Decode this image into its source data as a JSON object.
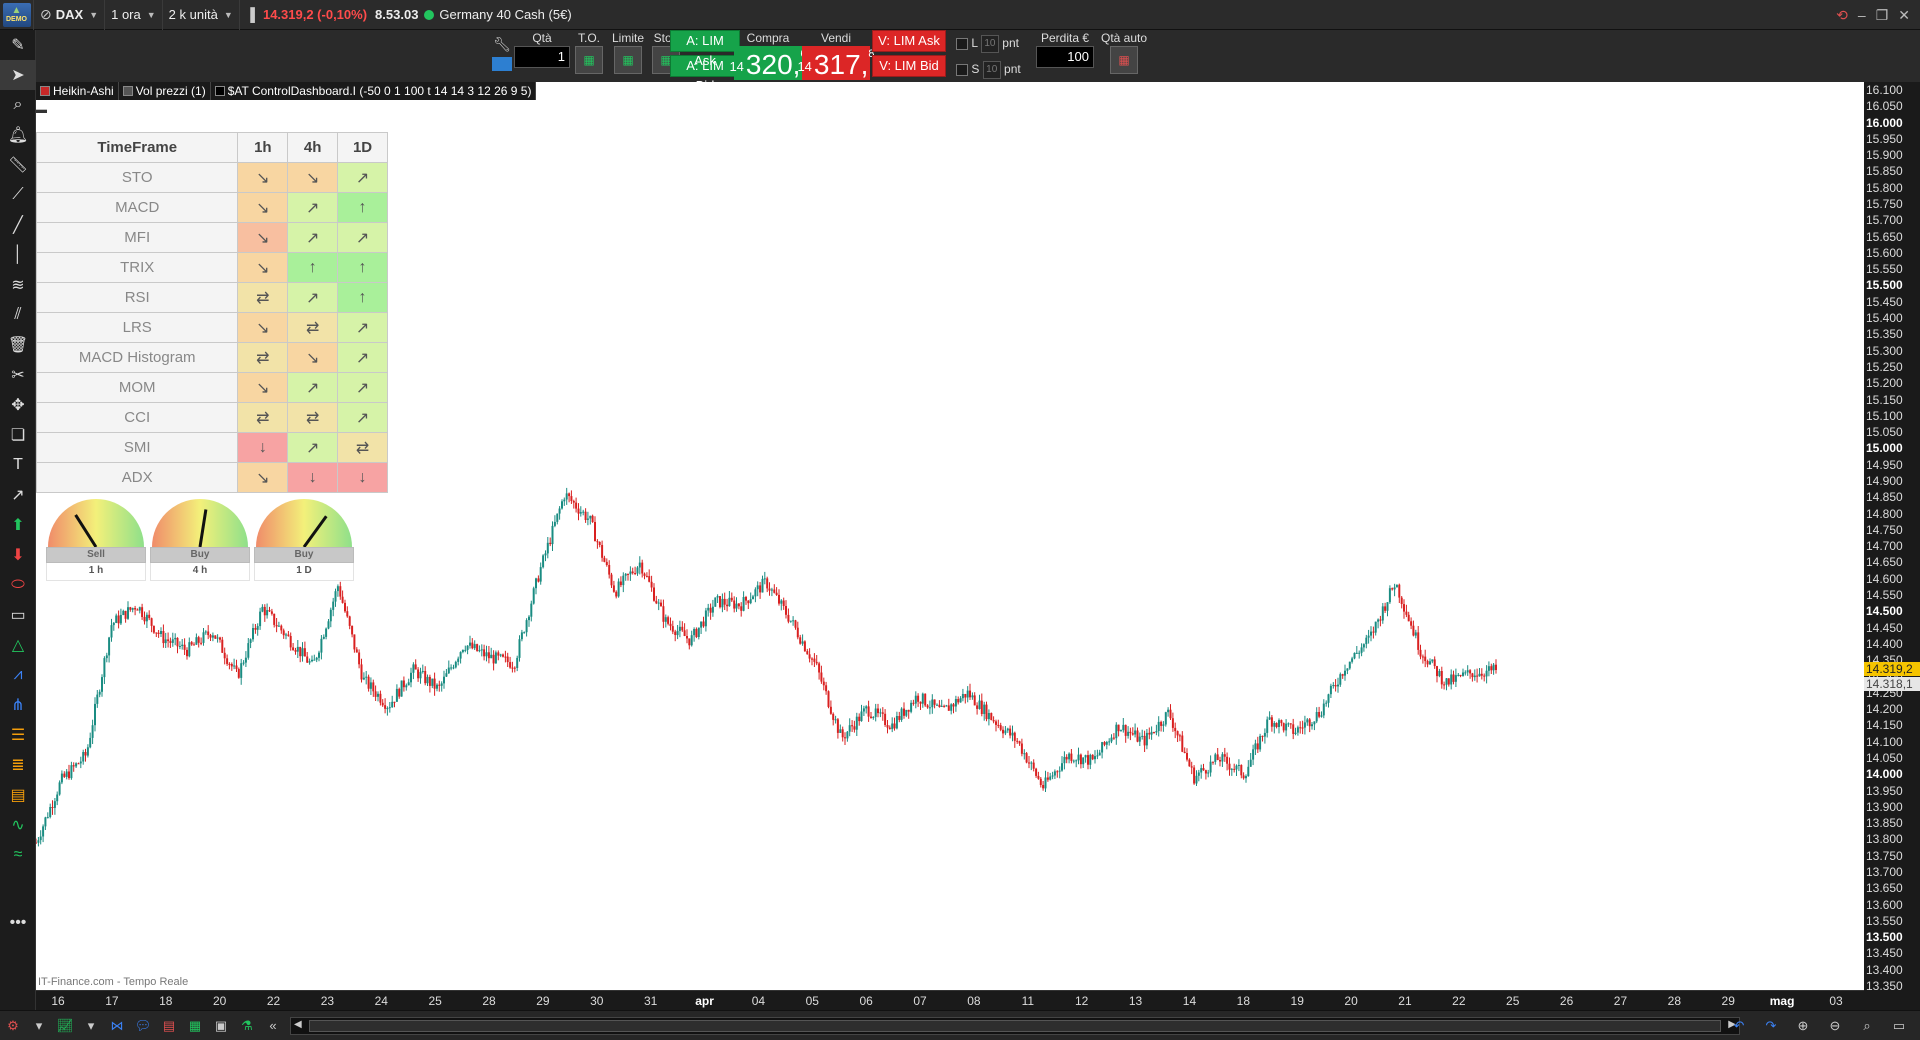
{
  "titlebar": {
    "demo_badge": "DEMO",
    "instrument": "DAX",
    "timeframe": "1 ora",
    "units": "2 k unità",
    "last_price": "14.319,2 (-0,10%)",
    "time": "8.53.03",
    "market_name": "Germany 40 Cash (5€)"
  },
  "tradebar": {
    "qty_label": "Qtà",
    "qty_value": "1",
    "to_label": "T.O.",
    "limit_label": "Limite",
    "stop_label": "Stop",
    "buy_ask_btn": "A: LIM Ask",
    "buy_bid_btn": "A: LIM Bid",
    "buy_label": "Compra",
    "buy_price_prefix": "14",
    "buy_price_main": "320,",
    "buy_price_sup": "6",
    "sell_label": "Vendi",
    "sell_price_prefix": "14",
    "sell_price_main": "317,",
    "sell_price_sup": "8",
    "sell_ask_btn": "V: LIM Ask",
    "sell_bid_btn": "V: LIM Bid",
    "l_label": "L",
    "s_label": "S",
    "l_value": "10",
    "s_value": "10",
    "pnt_label": "pnt",
    "loss_label": "Perdita €",
    "loss_value": "100",
    "auto_qty_label": "Qtà auto"
  },
  "legend": [
    {
      "label": "Heikin-Ashi",
      "color": "#c62828"
    },
    {
      "label": "Vol prezzi (1)",
      "color": "#555555"
    },
    {
      "label": "$AT ControlDashboard.I (-50 0 1 100 t 14 14 3 12 26 9 5)",
      "color": "#000000"
    }
  ],
  "dashboard": {
    "header": "TimeFrame",
    "columns": [
      "1h",
      "4h",
      "1D"
    ],
    "rows": [
      {
        "name": "STO",
        "cells": [
          {
            "arrow": "↘",
            "state": "down-soft"
          },
          {
            "arrow": "↘",
            "state": "down-soft"
          },
          {
            "arrow": "↗",
            "state": "up-soft"
          }
        ]
      },
      {
        "name": "MACD",
        "cells": [
          {
            "arrow": "↘",
            "state": "down-soft"
          },
          {
            "arrow": "↗",
            "state": "up-soft"
          },
          {
            "arrow": "↑",
            "state": "up-strong"
          }
        ]
      },
      {
        "name": "MFI",
        "cells": [
          {
            "arrow": "↘",
            "state": "down-mid"
          },
          {
            "arrow": "↗",
            "state": "up-soft"
          },
          {
            "arrow": "↗",
            "state": "up-soft"
          }
        ]
      },
      {
        "name": "TRIX",
        "cells": [
          {
            "arrow": "↘",
            "state": "down-soft"
          },
          {
            "arrow": "↑",
            "state": "up-strong"
          },
          {
            "arrow": "↑",
            "state": "up-strong"
          }
        ]
      },
      {
        "name": "RSI",
        "cells": [
          {
            "arrow": "⇄",
            "state": "neutral"
          },
          {
            "arrow": "↗",
            "state": "up-soft"
          },
          {
            "arrow": "↑",
            "state": "up-strong"
          }
        ]
      },
      {
        "name": "LRS",
        "cells": [
          {
            "arrow": "↘",
            "state": "down-soft"
          },
          {
            "arrow": "⇄",
            "state": "neutral"
          },
          {
            "arrow": "↗",
            "state": "up-soft"
          }
        ]
      },
      {
        "name": "MACD Histogram",
        "cells": [
          {
            "arrow": "⇄",
            "state": "neutral"
          },
          {
            "arrow": "↘",
            "state": "down-soft"
          },
          {
            "arrow": "↗",
            "state": "up-soft"
          }
        ]
      },
      {
        "name": "MOM",
        "cells": [
          {
            "arrow": "↘",
            "state": "down-soft"
          },
          {
            "arrow": "↗",
            "state": "up-soft"
          },
          {
            "arrow": "↗",
            "state": "up-soft"
          }
        ]
      },
      {
        "name": "CCI",
        "cells": [
          {
            "arrow": "⇄",
            "state": "neutral"
          },
          {
            "arrow": "⇄",
            "state": "neutral"
          },
          {
            "arrow": "↗",
            "state": "up-soft"
          }
        ]
      },
      {
        "name": "SMI",
        "cells": [
          {
            "arrow": "↓",
            "state": "down-strong"
          },
          {
            "arrow": "↗",
            "state": "up-soft"
          },
          {
            "arrow": "⇄",
            "state": "neutral"
          }
        ]
      },
      {
        "name": "ADX",
        "cells": [
          {
            "arrow": "↘",
            "state": "down-soft"
          },
          {
            "arrow": "↓",
            "state": "down-strong"
          },
          {
            "arrow": "↓",
            "state": "down-strong"
          }
        ]
      }
    ],
    "state_colors": {
      "up-strong": "#a9f09a",
      "up-soft": "#d6f3a8",
      "neutral": "#f2e3a8",
      "down-soft": "#f8d6a2",
      "down-mid": "#f8bfa0",
      "down-strong": "#f7a3a3"
    },
    "gauges": [
      {
        "signal": "Sell",
        "timeframe": "1 h",
        "needle": 0.32
      },
      {
        "signal": "Buy",
        "timeframe": "4 h",
        "needle": 0.55
      },
      {
        "signal": "Buy",
        "timeframe": "1 D",
        "needle": 0.7
      }
    ]
  },
  "price_axis": {
    "ticks": [
      "16.100",
      "16.050",
      "16.000",
      "15.950",
      "15.900",
      "15.850",
      "15.800",
      "15.750",
      "15.700",
      "15.650",
      "15.600",
      "15.550",
      "15.500",
      "15.450",
      "15.400",
      "15.350",
      "15.300",
      "15.250",
      "15.200",
      "15.150",
      "15.100",
      "15.050",
      "15.000",
      "14.950",
      "14.900",
      "14.850",
      "14.800",
      "14.750",
      "14.700",
      "14.650",
      "14.600",
      "14.550",
      "14.500",
      "14.450",
      "14.400",
      "14.350",
      "14.300",
      "14.250",
      "14.200",
      "14.150",
      "14.100",
      "14.050",
      "14.000",
      "13.950",
      "13.900",
      "13.850",
      "13.800",
      "13.750",
      "13.700",
      "13.650",
      "13.600",
      "13.550",
      "13.500",
      "13.450",
      "13.400",
      "13.350"
    ],
    "major": [
      "16.000",
      "15.500",
      "15.000",
      "14.500",
      "14.000",
      "13.500"
    ],
    "last_badge": "14.319,2",
    "bid_badge": "14.318,1",
    "last_badge_color": "#f5c400",
    "bid_badge_color": "#e6e6e6"
  },
  "time_axis": {
    "labels": [
      "16",
      "17",
      "18",
      "20",
      "22",
      "23",
      "24",
      "25",
      "28",
      "29",
      "30",
      "31",
      "apr",
      "04",
      "05",
      "06",
      "07",
      "08",
      "11",
      "12",
      "13",
      "14",
      "18",
      "19",
      "20",
      "21",
      "22",
      "25",
      "26",
      "27",
      "28",
      "29",
      "mag",
      "03"
    ],
    "bold": [
      "apr",
      "mag"
    ]
  },
  "watermark": "IT-Finance.com - Tempo Reale",
  "chart_data": {
    "type": "candlestick",
    "style": "Heikin-Ashi",
    "up_color": "#1a8c82",
    "down_color": "#d92020",
    "ylim": [
      13350,
      16100
    ],
    "x": [
      "16",
      "17",
      "18",
      "20",
      "22",
      "23",
      "24",
      "25",
      "28",
      "29",
      "30",
      "31",
      "apr",
      "04",
      "05",
      "06",
      "07",
      "08",
      "11",
      "12",
      "13",
      "14",
      "18",
      "19",
      "20",
      "21",
      "22"
    ],
    "close_path": [
      13790,
      13980,
      14060,
      14460,
      14520,
      14420,
      14380,
      14440,
      14300,
      14510,
      14420,
      14330,
      14580,
      14290,
      14210,
      14320,
      14260,
      14400,
      14360,
      14340,
      14620,
      14860,
      14780,
      14560,
      14650,
      14470,
      14410,
      14530,
      14520,
      14590,
      14470,
      14330,
      14110,
      14200,
      14150,
      14240,
      14190,
      14250,
      14170,
      14100,
      13960,
      14060,
      14040,
      14150,
      14100,
      14190,
      13990,
      14050,
      14000,
      14170,
      14130,
      14190,
      14330,
      14420,
      14590,
      14380,
      14280,
      14310,
      14319
    ]
  }
}
